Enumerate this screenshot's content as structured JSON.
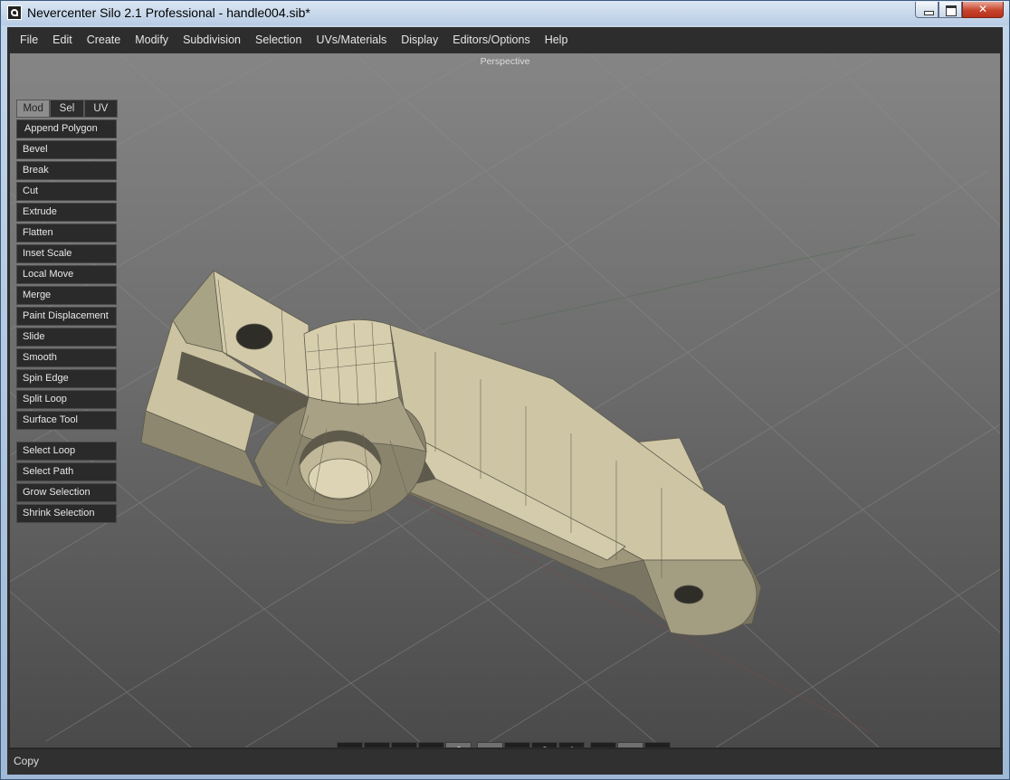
{
  "window": {
    "title": "Nevercenter Silo 2.1 Professional - handle004.sib*",
    "icon": "silo-app-icon",
    "controls": [
      "minimize-icon",
      "maximize-icon",
      "close-icon"
    ]
  },
  "menu": [
    "File",
    "Edit",
    "Create",
    "Modify",
    "Subdivision",
    "Selection",
    "UVs/Materials",
    "Display",
    "Editors/Options",
    "Help"
  ],
  "viewport": {
    "label": "Perspective"
  },
  "panel": {
    "tabs": [
      {
        "label": "Mod",
        "active": true
      },
      {
        "label": "Sel",
        "active": false
      },
      {
        "label": "UV",
        "active": false
      }
    ],
    "tools": [
      "Append Polygon",
      "Bevel",
      "Break",
      "Cut",
      "Extrude",
      "Flatten",
      "Inset Scale",
      "Local Move",
      "Merge",
      "Paint Displacement",
      "Slide",
      "Smooth",
      "Spin Edge",
      "Split Loop",
      "Surface Tool"
    ],
    "selection_tools": [
      "Select Loop",
      "Select Path",
      "Grow Selection",
      "Shrink Selection"
    ]
  },
  "toolbar": {
    "groups": [
      [
        "vertex-mode-icon",
        "edge-mode-icon",
        "face-mode-icon",
        "face-select-icon",
        "object-mode-icon"
      ],
      [
        "move-manipulator-icon",
        "rotate-manipulator-icon",
        "scale-manipulator-icon",
        "universal-manipulator-icon"
      ],
      [
        "lasso-select-icon",
        "rectangle-select-icon",
        "paint-select-icon"
      ]
    ],
    "active": [
      "object-mode-icon",
      "move-manipulator-icon",
      "rectangle-select-icon"
    ]
  },
  "status": {
    "text": "Copy"
  },
  "colors": {
    "model_light": "#d0c8a8",
    "model_mid": "#a19a7e",
    "model_dark": "#6e6958",
    "ui_bg": "#2d2d2d"
  }
}
